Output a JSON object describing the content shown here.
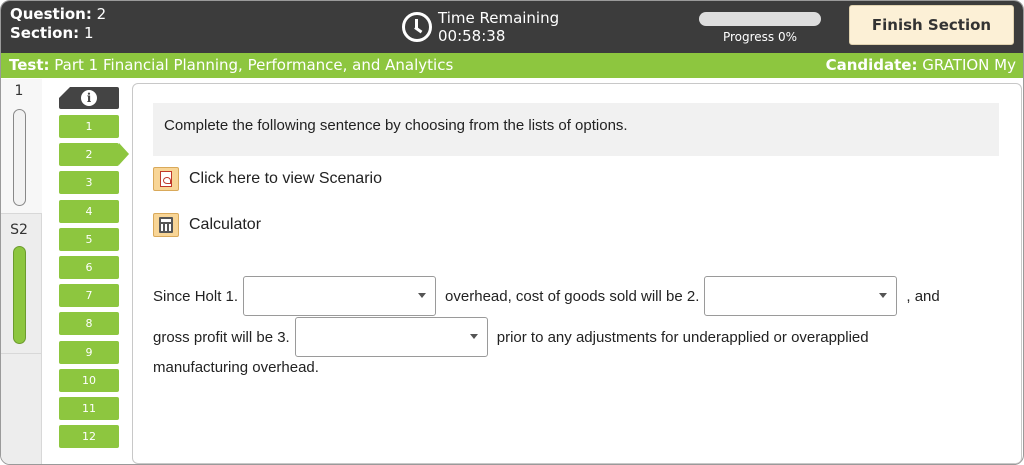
{
  "header": {
    "question_label": "Question:",
    "question_value": "2",
    "section_label": "Section:",
    "section_value": "1",
    "timer_label": "Time Remaining",
    "timer_value": "00:58:38",
    "progress_label": "Progress 0%",
    "progress_fraction": 0,
    "finish_button": "Finish Section"
  },
  "testbar": {
    "test_label": "Test:",
    "test_name": "Part 1 Financial Planning, Performance, and Analytics",
    "candidate_label": "Candidate:",
    "candidate_name": "GRATION My"
  },
  "sections": [
    {
      "label": "1"
    },
    {
      "label": "S2"
    }
  ],
  "nav": {
    "questions": [
      "1",
      "2",
      "3",
      "4",
      "5",
      "6",
      "7",
      "8",
      "9",
      "10",
      "11",
      "12"
    ],
    "active_index": 1
  },
  "main": {
    "prompt": "Complete the following sentence by choosing from the lists of options.",
    "scenario_link": "Click here to view Scenario",
    "calculator_link": "Calculator",
    "sentence": {
      "part1": "Since Holt 1.",
      "part2": "overhead, cost of goods sold will be 2.",
      "part3": ", and",
      "part4": "gross profit will be 3.",
      "part5": "prior to any adjustments for underapplied or overapplied",
      "part6": "manufacturing overhead.",
      "dropdowns": [
        "",
        "",
        ""
      ]
    }
  },
  "colors": {
    "header_bg": "#3c3c3c",
    "accent_green": "#8dc63f",
    "finish_bg": "#fcf0d6",
    "tool_icon_bg": "#f8d596"
  }
}
